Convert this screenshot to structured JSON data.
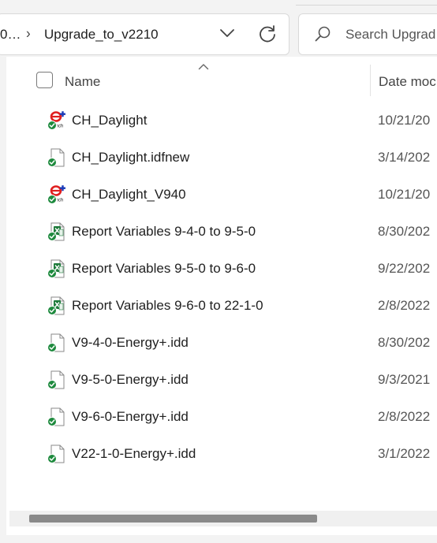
{
  "address": {
    "prev_crumb": "0…",
    "separator": "›",
    "current_folder": "Upgrade_to_v2210"
  },
  "search": {
    "placeholder": "Search Upgrad"
  },
  "columns": {
    "name": "Name",
    "date": "Date moc"
  },
  "files": [
    {
      "name": "CH_Daylight",
      "date": "10/21/20",
      "icon": "energyplus-input-icon"
    },
    {
      "name": "CH_Daylight.idfnew",
      "date": "3/14/202",
      "icon": "generic-file-icon"
    },
    {
      "name": "CH_Daylight_V940",
      "date": "10/21/20",
      "icon": "energyplus-input-icon"
    },
    {
      "name": "Report Variables 9-4-0 to 9-5-0",
      "date": "8/30/202",
      "icon": "spreadsheet-file-icon"
    },
    {
      "name": "Report Variables 9-5-0 to 9-6-0",
      "date": "9/22/202",
      "icon": "spreadsheet-file-icon"
    },
    {
      "name": "Report Variables 9-6-0 to 22-1-0",
      "date": "2/8/2022",
      "icon": "spreadsheet-file-icon"
    },
    {
      "name": "V9-4-0-Energy+.idd",
      "date": "8/30/202",
      "icon": "generic-file-icon"
    },
    {
      "name": "V9-5-0-Energy+.idd",
      "date": "9/3/2021",
      "icon": "generic-file-icon"
    },
    {
      "name": "V9-6-0-Energy+.idd",
      "date": "2/8/2022",
      "icon": "generic-file-icon"
    },
    {
      "name": "V22-1-0-Energy+.idd",
      "date": "3/1/2022",
      "icon": "generic-file-icon"
    }
  ],
  "colors": {
    "sync_green": "#1e8a3e",
    "energyplus_red": "#e02020",
    "energyplus_blue": "#1a3bb8",
    "excel_green": "#1d7a3a"
  }
}
